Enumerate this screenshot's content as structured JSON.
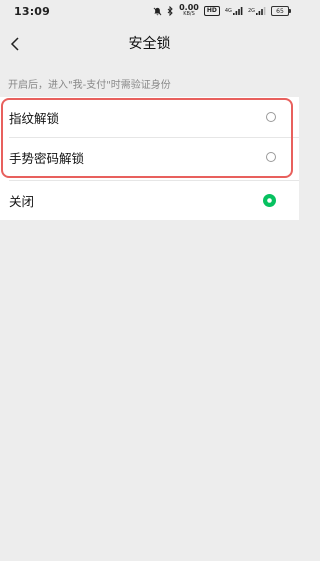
{
  "status_bar": {
    "time": "13:09",
    "net_speed_value": "0.00",
    "net_speed_unit": "KB/S",
    "hd_label": "HD",
    "signal1_label": "4G",
    "signal2_label": "2G",
    "battery_level": "65"
  },
  "navbar": {
    "title": "安全锁"
  },
  "hint": "开启后，进入\"我-支付\"时需验证身份",
  "options": [
    {
      "label": "指纹解锁",
      "selected": false
    },
    {
      "label": "手势密码解锁",
      "selected": false
    },
    {
      "label": "关闭",
      "selected": true
    }
  ],
  "colors": {
    "accent": "#07c160",
    "highlight": "#e8605d"
  }
}
